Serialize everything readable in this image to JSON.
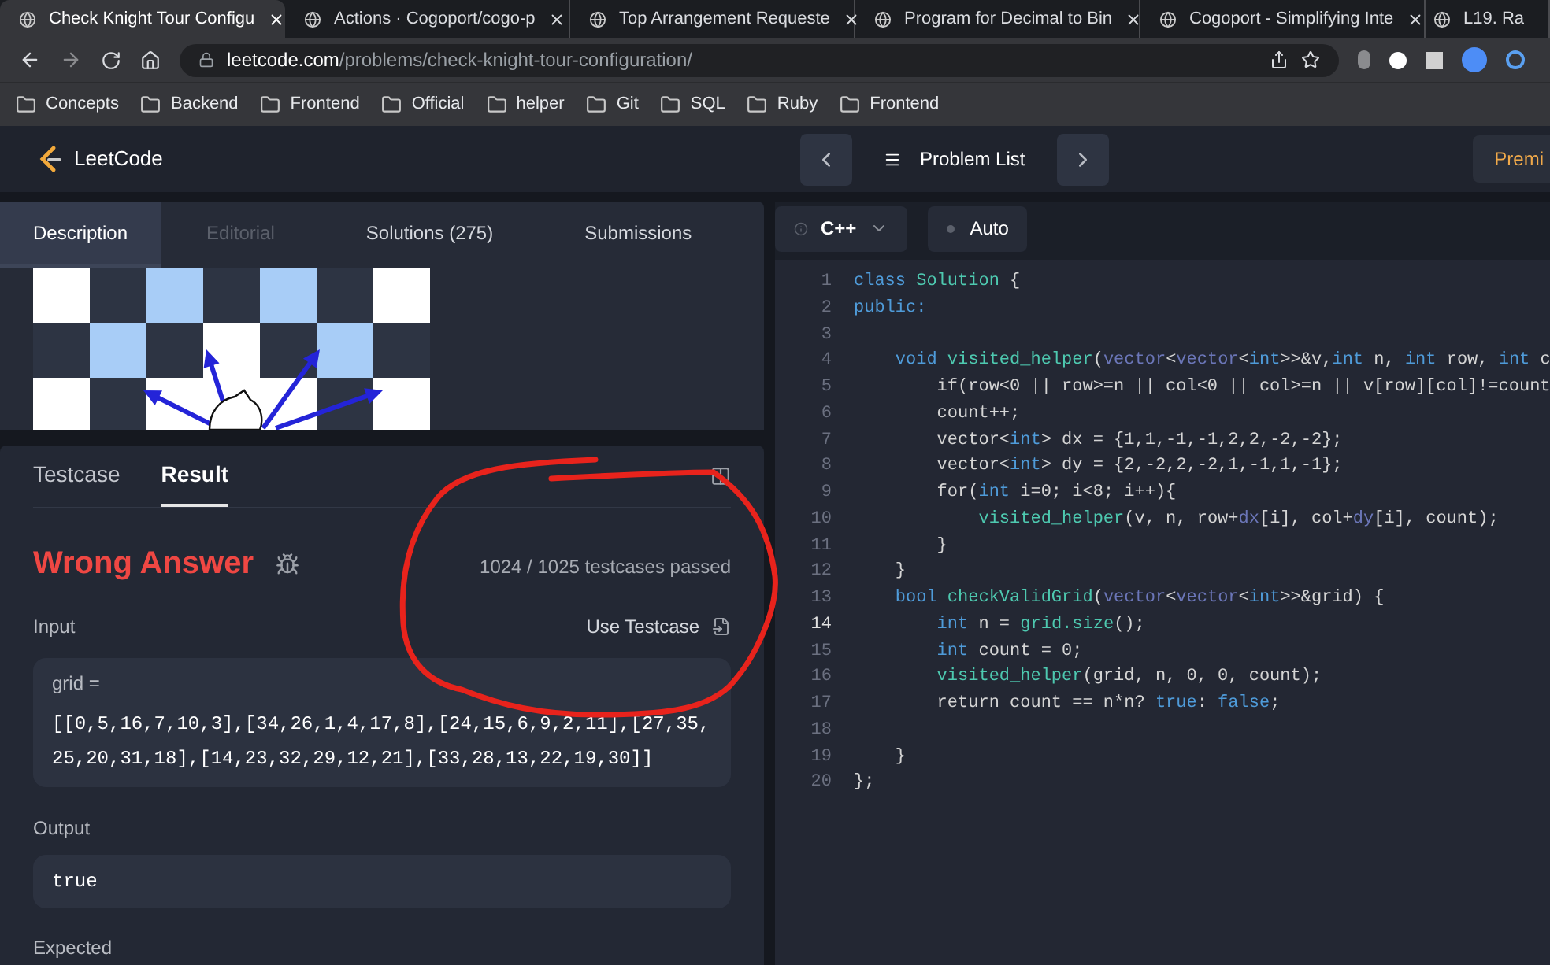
{
  "browser": {
    "tabs": [
      {
        "title": "Check Knight Tour Configu",
        "selected": true
      },
      {
        "title": "Actions · Cogoport/cogo-p",
        "selected": false
      },
      {
        "title": "Top Arrangement Requeste",
        "selected": false
      },
      {
        "title": "Program for Decimal to Bin",
        "selected": false
      },
      {
        "title": "Cogoport - Simplifying Inte",
        "selected": false
      },
      {
        "title": "L19. Ra",
        "selected": false
      }
    ],
    "url": {
      "host": "leetcode.com",
      "path": "/problems/check-knight-tour-configuration/"
    },
    "bookmarks": [
      "Concepts",
      "Backend",
      "Frontend",
      "Official",
      "helper",
      "Git",
      "SQL",
      "Ruby",
      "Frontend"
    ]
  },
  "header": {
    "logo": "LeetCode",
    "problem_list": "Problem List",
    "premium": "Premi"
  },
  "description_tabs": [
    {
      "label": "Description",
      "selected": true,
      "disabled": false
    },
    {
      "label": "Editorial",
      "selected": false,
      "disabled": true
    },
    {
      "label": "Solutions (275)",
      "selected": false,
      "disabled": false
    },
    {
      "label": "Submissions",
      "selected": false,
      "disabled": false
    }
  ],
  "result_tabs": [
    {
      "label": "Testcase",
      "selected": false
    },
    {
      "label": "Result",
      "selected": true
    }
  ],
  "result": {
    "status": "Wrong Answer",
    "passed": "1024 / 1025",
    "passed_label": "testcases passed",
    "input_label": "Input",
    "use_testcase": "Use Testcase",
    "input_name": "grid =",
    "input_value": "[[0,5,16,7,10,3],[34,26,1,4,17,8],[24,15,6,9,2,11],[27,35,25,20,31,18],[14,23,32,29,12,21],[33,28,13,22,19,30]]",
    "output_label": "Output",
    "output_value": "true",
    "expected_label": "Expected"
  },
  "editor": {
    "language": "C++",
    "mode": "Auto",
    "lines": [
      {
        "number": "1",
        "current": false,
        "tokens": [
          {
            "kind": "kw",
            "text": "class "
          },
          {
            "kind": "fn",
            "text": "Solution"
          },
          {
            "kind": "plain",
            "text": " {"
          }
        ]
      },
      {
        "number": "2",
        "current": false,
        "tokens": [
          {
            "kind": "kw",
            "text": "public:"
          }
        ]
      },
      {
        "number": "3",
        "current": false
      },
      {
        "number": "4",
        "current": false,
        "tokens": [
          {
            "kind": "kw",
            "text": "    void "
          },
          {
            "kind": "fn",
            "text": "visited_helper"
          },
          {
            "kind": "plain",
            "text": "("
          },
          {
            "kind": "type",
            "text": "vector"
          },
          {
            "kind": "plain",
            "text": "<"
          },
          {
            "kind": "type",
            "text": "vector"
          },
          {
            "kind": "plain",
            "text": "<"
          },
          {
            "kind": "kw",
            "text": "int"
          },
          {
            "kind": "plain",
            "text": ">>&v,"
          },
          {
            "kind": "kw",
            "text": "int"
          },
          {
            "kind": "plain",
            "text": " n, "
          },
          {
            "kind": "kw",
            "text": "int"
          },
          {
            "kind": "plain",
            "text": " row, "
          },
          {
            "kind": "kw",
            "text": "int"
          },
          {
            "kind": "plain",
            "text": " c"
          }
        ]
      },
      {
        "number": "5",
        "current": false,
        "tokens": [
          {
            "kind": "plain",
            "text": "        if(row<0 || row>=n || col<0 || col>=n || v[row][col]!=count"
          }
        ]
      },
      {
        "number": "6",
        "current": false,
        "tokens": [
          {
            "kind": "plain",
            "text": "        count++;"
          }
        ]
      },
      {
        "number": "7",
        "current": false,
        "tokens": [
          {
            "kind": "plain",
            "text": "        vector<"
          },
          {
            "kind": "kw",
            "text": "int"
          },
          {
            "kind": "plain",
            "text": "> dx = {1,1,-1,-1,2,2,-2,-2};"
          }
        ]
      },
      {
        "number": "8",
        "current": false,
        "tokens": [
          {
            "kind": "plain",
            "text": "        vector<"
          },
          {
            "kind": "kw",
            "text": "int"
          },
          {
            "kind": "plain",
            "text": "> dy = {2,-2,2,-2,1,-1,1,-1};"
          }
        ]
      },
      {
        "number": "9",
        "current": false,
        "tokens": [
          {
            "kind": "plain",
            "text": "        for("
          },
          {
            "kind": "kw",
            "text": "int"
          },
          {
            "kind": "plain",
            "text": " i=0; i<8; i++){"
          }
        ]
      },
      {
        "number": "10",
        "current": false,
        "tokens": [
          {
            "kind": "fn",
            "text": "            visited_helper"
          },
          {
            "kind": "plain",
            "text": "(v, n, row+"
          },
          {
            "kind": "type",
            "text": "dx"
          },
          {
            "kind": "plain",
            "text": "[i], col+"
          },
          {
            "kind": "type",
            "text": "dy"
          },
          {
            "kind": "plain",
            "text": "[i], count);"
          }
        ]
      },
      {
        "number": "11",
        "current": false,
        "tokens": [
          {
            "kind": "plain",
            "text": "        }"
          }
        ]
      },
      {
        "number": "12",
        "current": false,
        "tokens": [
          {
            "kind": "plain",
            "text": "    }"
          }
        ]
      },
      {
        "number": "13",
        "current": false,
        "tokens": [
          {
            "kind": "kw",
            "text": "    bool "
          },
          {
            "kind": "fn",
            "text": "checkValidGrid"
          },
          {
            "kind": "plain",
            "text": "("
          },
          {
            "kind": "type",
            "text": "vector"
          },
          {
            "kind": "plain",
            "text": "<"
          },
          {
            "kind": "type",
            "text": "vector"
          },
          {
            "kind": "plain",
            "text": "<"
          },
          {
            "kind": "kw",
            "text": "int"
          },
          {
            "kind": "plain",
            "text": ">>&grid) {"
          }
        ]
      },
      {
        "number": "14",
        "current": true,
        "tokens": [
          {
            "kind": "kw",
            "text": "        int"
          },
          {
            "kind": "plain",
            "text": " n = "
          },
          {
            "kind": "fn",
            "text": "grid.size"
          },
          {
            "kind": "plain",
            "text": "();"
          }
        ]
      },
      {
        "number": "15",
        "current": false,
        "tokens": [
          {
            "kind": "kw",
            "text": "        int"
          },
          {
            "kind": "plain",
            "text": " count = 0;"
          }
        ]
      },
      {
        "number": "16",
        "current": false,
        "tokens": [
          {
            "kind": "fn",
            "text": "        visited_helper"
          },
          {
            "kind": "plain",
            "text": "(grid, n, 0, 0, count);"
          }
        ]
      },
      {
        "number": "17",
        "current": false,
        "tokens": [
          {
            "kind": "plain",
            "text": "        return count == n*n? "
          },
          {
            "kind": "kw",
            "text": "true"
          },
          {
            "kind": "plain",
            "text": ": "
          },
          {
            "kind": "kw",
            "text": "false"
          },
          {
            "kind": "plain",
            "text": ";"
          }
        ]
      },
      {
        "number": "18",
        "current": false
      },
      {
        "number": "19",
        "current": false,
        "tokens": [
          {
            "kind": "plain",
            "text": "    }"
          }
        ]
      },
      {
        "number": "20",
        "current": false,
        "tokens": [
          {
            "kind": "plain",
            "text": "};"
          }
        ]
      }
    ]
  }
}
